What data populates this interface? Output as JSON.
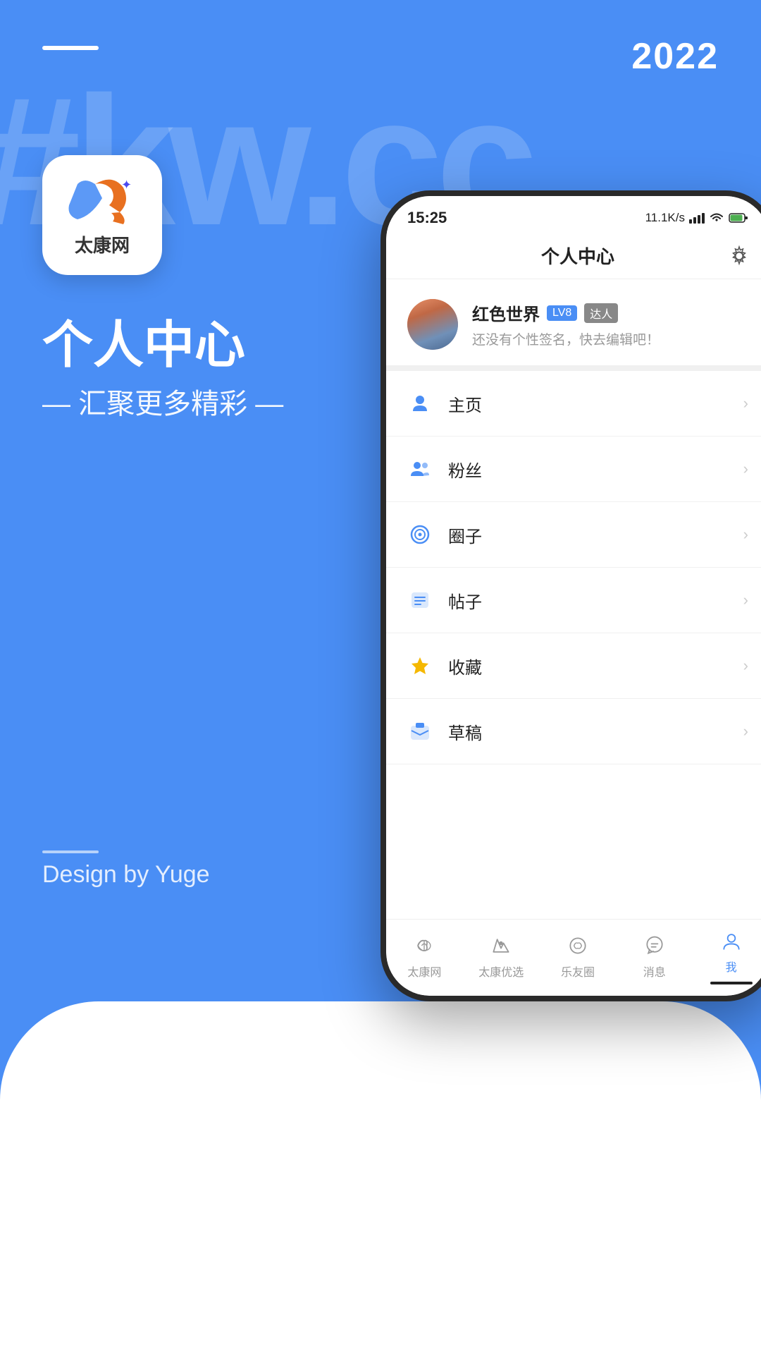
{
  "background": {
    "watermark": "#kw.cc",
    "year": "2022",
    "color": "#4a8ef5"
  },
  "left_panel": {
    "app_name": "太康网",
    "title": "个人中心",
    "subtitle": "— 汇聚更多精彩 —",
    "design_credit": "Design by Yuge"
  },
  "phone": {
    "status_bar": {
      "time": "15:25",
      "network_speed": "11.1K/s"
    },
    "header": {
      "title": "个人中心",
      "gear_label": "settings"
    },
    "profile": {
      "name": "红色世界",
      "level": "LV8",
      "tag": "达人",
      "bio": "还没有个性签名，快去编辑吧！"
    },
    "menu_items": [
      {
        "id": "home",
        "label": "主页",
        "icon_type": "person"
      },
      {
        "id": "fans",
        "label": "粉丝",
        "icon_type": "person-outline"
      },
      {
        "id": "circle",
        "label": "圈子",
        "icon_type": "circle"
      },
      {
        "id": "posts",
        "label": "帖子",
        "icon_type": "document"
      },
      {
        "id": "favorites",
        "label": "收藏",
        "icon_type": "star"
      },
      {
        "id": "drafts",
        "label": "草稿",
        "icon_type": "inbox"
      }
    ],
    "tab_bar": [
      {
        "id": "home",
        "label": "太康网",
        "active": false
      },
      {
        "id": "deals",
        "label": "太康优选",
        "active": false
      },
      {
        "id": "circle",
        "label": "乐友圈",
        "active": false
      },
      {
        "id": "messages",
        "label": "消息",
        "active": false
      },
      {
        "id": "me",
        "label": "我",
        "active": true
      }
    ]
  }
}
